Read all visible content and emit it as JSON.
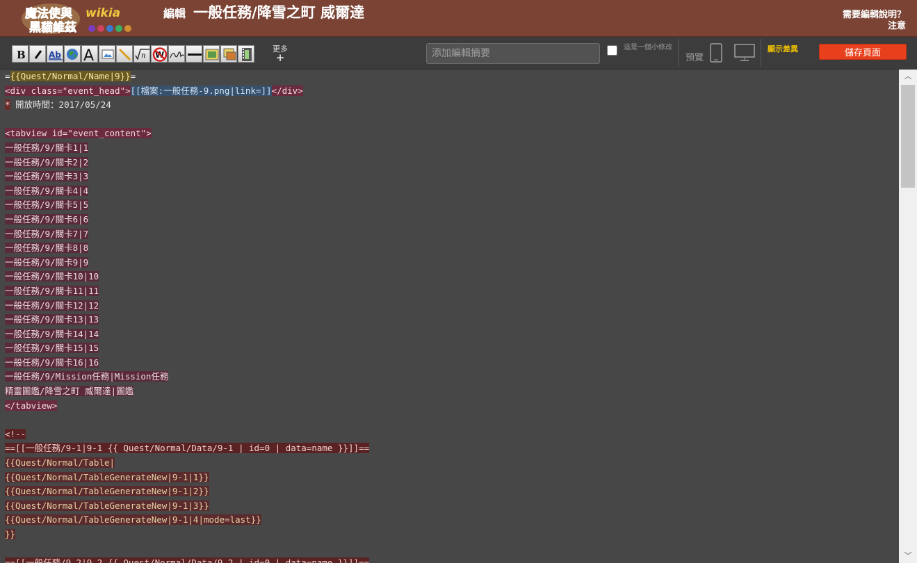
{
  "header": {
    "logo_text": "魔法使與黑貓維茲 wikia",
    "edit_prefix": "編輯",
    "page_title": "一般任務/降雪之町 威爾達",
    "help_line1": "需要編輯說明？",
    "help_line2": "注意"
  },
  "toolbar": {
    "buttons": [
      "bold-icon",
      "italic-icon",
      "internal-link-icon",
      "external-link-icon",
      "heading-icon",
      "image-icon",
      "signature-pen-icon",
      "math-icon",
      "nowiki-icon",
      "signature-icon",
      "horizontal-rule-icon",
      "gallery-icon",
      "slideshow-icon",
      "video-icon"
    ],
    "more_label": "更多",
    "more_plus": "+",
    "summary_placeholder": "添加編輯摘要",
    "minor_label": "這是一個小修改",
    "preview_label": "預覽",
    "diff_label": "顯示差異",
    "save_label": "儲存頁面",
    "accent_save": "#e8401c",
    "accent_diff": "#f0c000"
  },
  "editor": {
    "lines": [
      [
        [
          "txt",
          "="
        ],
        [
          "tmplb",
          "{{Quest/Normal/Name|9}}"
        ],
        [
          "txt",
          "="
        ]
      ],
      [
        [
          "tag",
          "<div class=\"event_head\">"
        ],
        [
          "link",
          "[[檔案:一般任務-9.png|link=]]"
        ],
        [
          "tag",
          "</div>"
        ]
      ],
      [
        [
          "bullet",
          "*"
        ],
        [
          "txt",
          " 開放時間：2017/05/24"
        ]
      ],
      [],
      [
        [
          "tag",
          "<tabview id=\"event_content\">"
        ]
      ],
      [
        [
          "plain",
          "一般任務/9/關卡1|1"
        ]
      ],
      [
        [
          "plain",
          "一般任務/9/關卡2|2"
        ]
      ],
      [
        [
          "plain",
          "一般任務/9/關卡3|3"
        ]
      ],
      [
        [
          "plain",
          "一般任務/9/關卡4|4"
        ]
      ],
      [
        [
          "plain",
          "一般任務/9/關卡5|5"
        ]
      ],
      [
        [
          "plain",
          "一般任務/9/關卡6|6"
        ]
      ],
      [
        [
          "plain",
          "一般任務/9/關卡7|7"
        ]
      ],
      [
        [
          "plain",
          "一般任務/9/關卡8|8"
        ]
      ],
      [
        [
          "plain",
          "一般任務/9/關卡9|9"
        ]
      ],
      [
        [
          "plain",
          "一般任務/9/關卡10|10"
        ]
      ],
      [
        [
          "plain",
          "一般任務/9/關卡11|11"
        ]
      ],
      [
        [
          "plain",
          "一般任務/9/關卡12|12"
        ]
      ],
      [
        [
          "plain",
          "一般任務/9/關卡13|13"
        ]
      ],
      [
        [
          "plain",
          "一般任務/9/關卡14|14"
        ]
      ],
      [
        [
          "plain",
          "一般任務/9/關卡15|15"
        ]
      ],
      [
        [
          "plain",
          "一般任務/9/關卡16|16"
        ]
      ],
      [
        [
          "plain",
          "一般任務/9/Mission任務|Mission任務"
        ]
      ],
      [
        [
          "plain",
          "精靈圖鑑/降雪之町 威爾達|圖鑑"
        ]
      ],
      [
        [
          "tag",
          "</tabview>"
        ]
      ],
      [],
      [
        [
          "comment",
          "<!--"
        ]
      ],
      [
        [
          "comment",
          "==[[一般任務/9-1|9-1 {{ Quest/Normal/Data/9-1 | id=0 | data=name }}]]=="
        ]
      ],
      [
        [
          "tmpl",
          "{{Quest/Normal/Table|"
        ]
      ],
      [
        [
          "tmpl",
          "{{Quest/Normal/TableGenerateNew|9-1|1}}"
        ]
      ],
      [
        [
          "tmpl",
          "{{Quest/Normal/TableGenerateNew|9-1|2}}"
        ]
      ],
      [
        [
          "tmpl",
          "{{Quest/Normal/TableGenerateNew|9-1|3}}"
        ]
      ],
      [
        [
          "tmpl",
          "{{Quest/Normal/TableGenerateNew|9-1|4|mode=last}}"
        ]
      ],
      [
        [
          "tmpl",
          "}}"
        ]
      ],
      [],
      [
        [
          "comment",
          "==[[一般任務/9-2|9-2 {{ Quest/Normal/Data/9-2 | id=0 | data=name }}]]=="
        ]
      ]
    ]
  },
  "scrollbar": {
    "up_arrow": "︿",
    "down_arrow": "﹀"
  }
}
